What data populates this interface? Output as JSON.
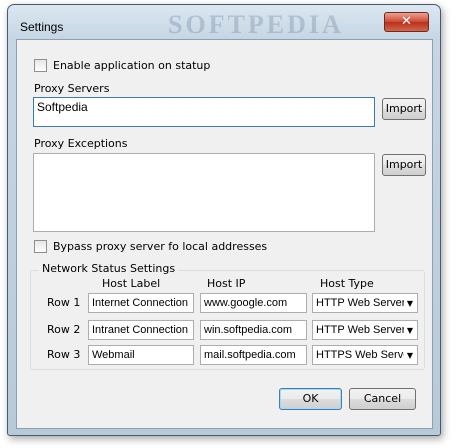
{
  "window": {
    "title": "Settings",
    "watermark": "SOFTPEDIA",
    "close_glyph": "✕"
  },
  "startup": {
    "label": "Enable application on statup",
    "checked": false
  },
  "proxy_servers": {
    "label": "Proxy Servers",
    "value": "Softpedia",
    "import_label": "Import"
  },
  "proxy_exceptions": {
    "label": "Proxy Exceptions",
    "value": "",
    "import_label": "Import"
  },
  "bypass": {
    "label": "Bypass proxy server fo local addresses",
    "checked": false
  },
  "network_status": {
    "title": "Network Status Settings",
    "columns": [
      "Host Label",
      "Host IP",
      "Host Type"
    ],
    "rows": [
      {
        "label": "Row 1",
        "host_label": "Internet Connection",
        "host_ip": "www.google.com",
        "host_type": "HTTP Web Server"
      },
      {
        "label": "Row 2",
        "host_label": "Intranet Connection",
        "host_ip": "win.softpedia.com",
        "host_type": "HTTP Web Server"
      },
      {
        "label": "Row 3",
        "host_label": "Webmail",
        "host_ip": "mail.softpedia.com",
        "host_type": "HTTPS Web Server"
      }
    ],
    "dropdown_icon": "chevron-down-icon"
  },
  "footer": {
    "ok_label": "OK",
    "cancel_label": "Cancel"
  },
  "colors": {
    "close_button": "#cf4b35",
    "focus_border": "#3d7bad",
    "dialog_face": "#f0f0f0"
  }
}
